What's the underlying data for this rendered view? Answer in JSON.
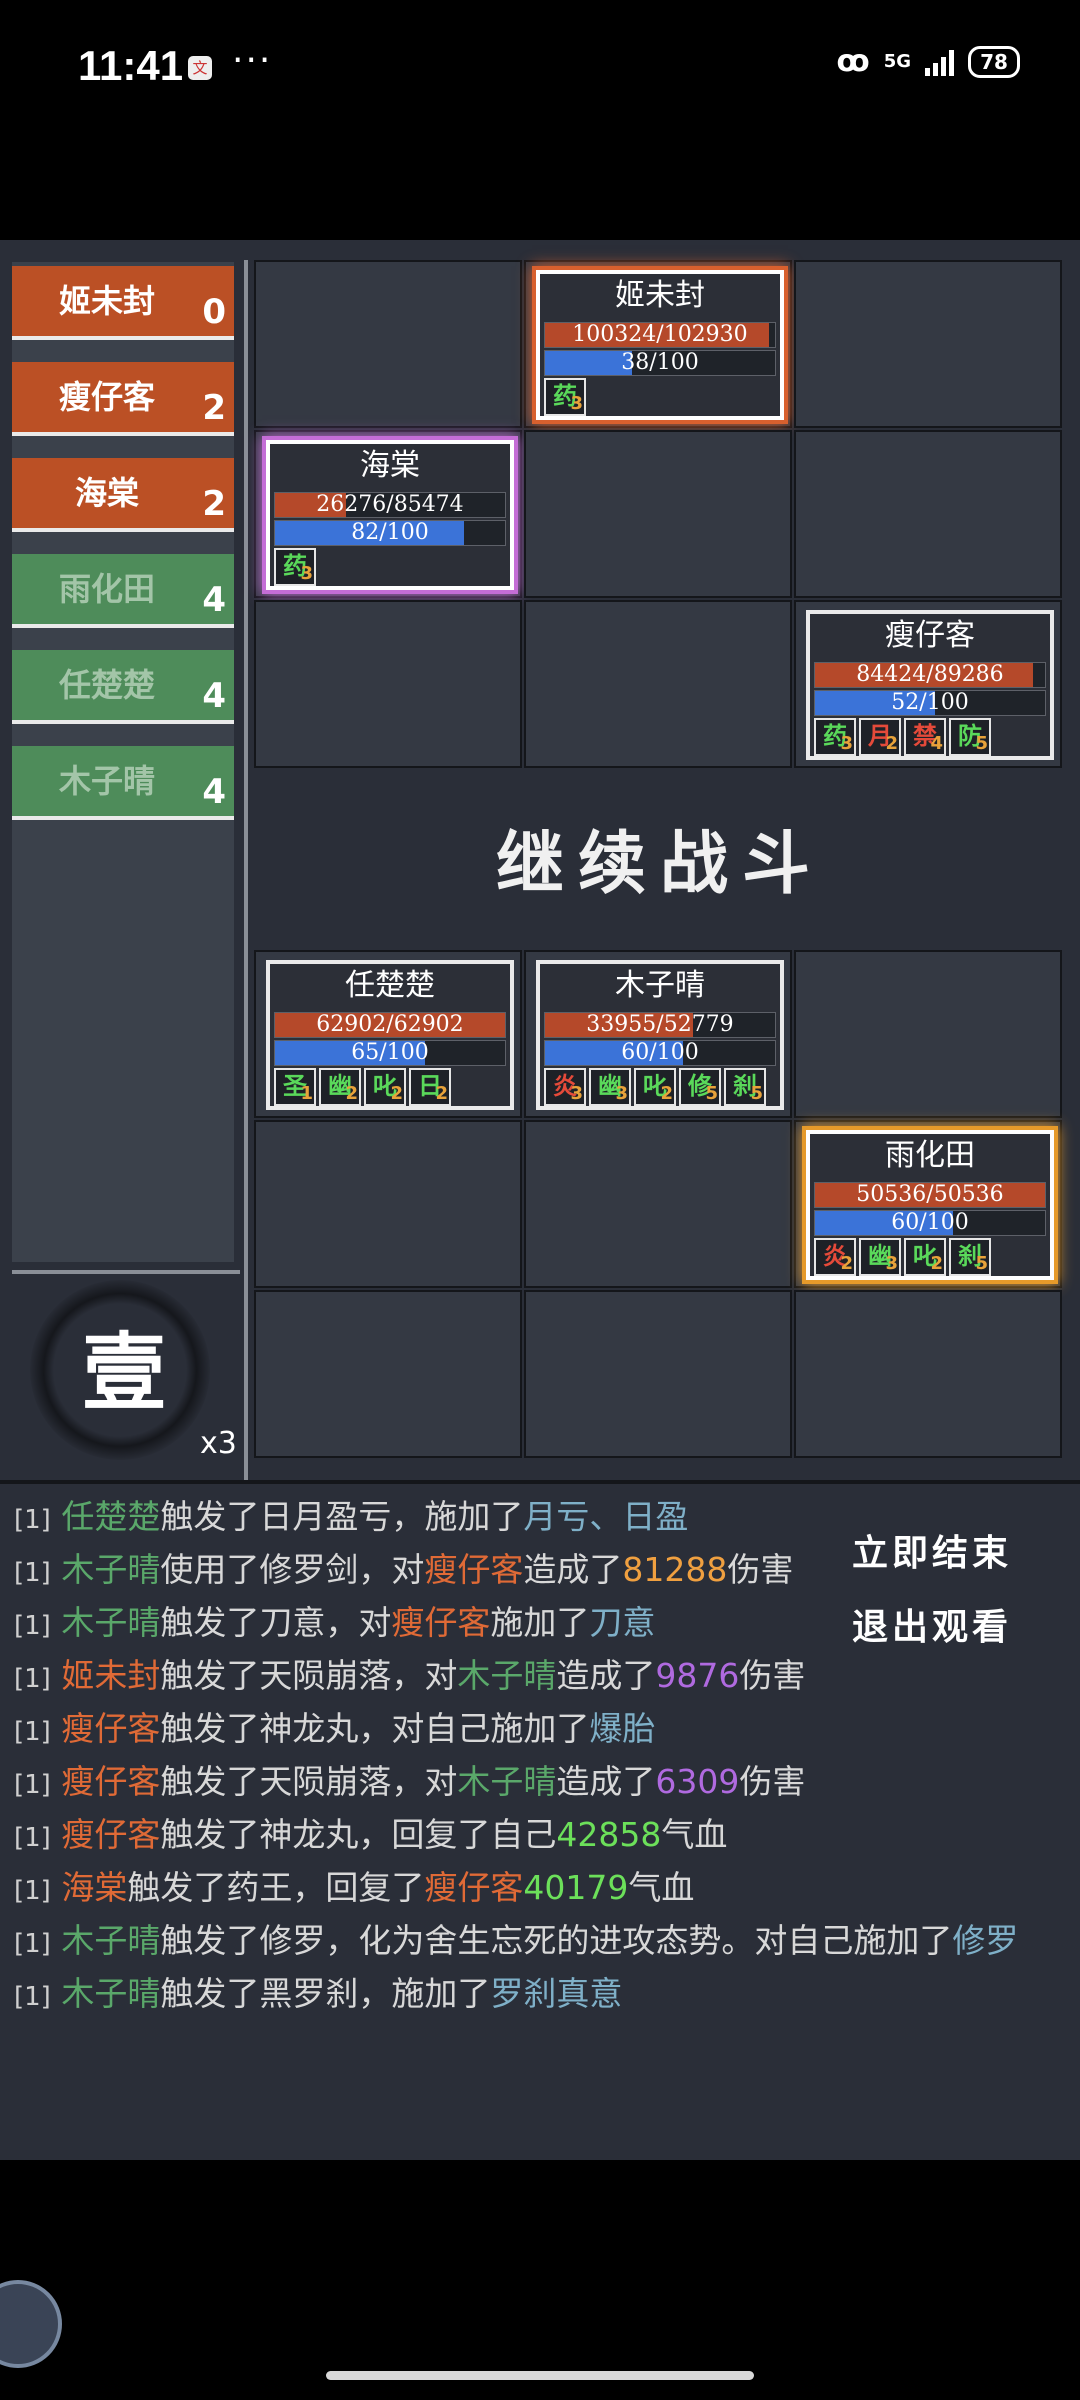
{
  "status_bar": {
    "time": "11:41",
    "network": "5G",
    "battery": "78"
  },
  "teams": [
    {
      "name": "姬未封",
      "count": "0",
      "color": "red"
    },
    {
      "name": "瘦仔客",
      "count": "2",
      "color": "red"
    },
    {
      "name": "海棠",
      "count": "2",
      "color": "red"
    },
    {
      "name": "雨化田",
      "count": "4",
      "color": "green"
    },
    {
      "name": "任楚楚",
      "count": "4",
      "color": "green"
    },
    {
      "name": "木子晴",
      "count": "4",
      "color": "green"
    }
  ],
  "round": {
    "char": "壹",
    "speed": "x3"
  },
  "enemy_units": {
    "ji": {
      "name": "姬未封",
      "hp": "100324/102930",
      "hp_frac": 0.975,
      "energy": "38/100",
      "energy_frac": 0.38,
      "buffs": [
        {
          "char": "药",
          "level": "3",
          "color": "green"
        }
      ]
    },
    "haitang": {
      "name": "海棠",
      "hp": "26276/85474",
      "hp_frac": 0.307,
      "energy": "82/100",
      "energy_frac": 0.82,
      "buffs": [
        {
          "char": "药",
          "level": "3",
          "color": "green"
        }
      ]
    },
    "shou": {
      "name": "瘦仔客",
      "hp": "84424/89286",
      "hp_frac": 0.946,
      "energy": "52/100",
      "energy_frac": 0.52,
      "buffs": [
        {
          "char": "药",
          "level": "3",
          "color": "green"
        },
        {
          "char": "月",
          "level": "2",
          "color": "red"
        },
        {
          "char": "禁",
          "level": "4",
          "color": "red"
        },
        {
          "char": "防",
          "level": "5",
          "color": "green"
        }
      ]
    }
  },
  "continue_label": "继续战斗",
  "ally_units": {
    "ren": {
      "name": "任楚楚",
      "hp": "62902/62902",
      "hp_frac": 1.0,
      "energy": "65/100",
      "energy_frac": 0.65,
      "buffs": [
        {
          "char": "圣",
          "level": "1",
          "color": "green"
        },
        {
          "char": "幽",
          "level": "2",
          "color": "green"
        },
        {
          "char": "叱",
          "level": "2",
          "color": "green"
        },
        {
          "char": "日",
          "level": "2",
          "color": "green"
        }
      ]
    },
    "mu": {
      "name": "木子晴",
      "hp": "33955/52779",
      "hp_frac": 0.643,
      "energy": "60/100",
      "energy_frac": 0.6,
      "buffs": [
        {
          "char": "炎",
          "level": "3",
          "color": "red"
        },
        {
          "char": "幽",
          "level": "3",
          "color": "green"
        },
        {
          "char": "叱",
          "level": "2",
          "color": "green"
        },
        {
          "char": "修",
          "level": "5",
          "color": "green"
        },
        {
          "char": "刹",
          "level": "5",
          "color": "green"
        }
      ]
    },
    "yu": {
      "name": "雨化田",
      "hp": "50536/50536",
      "hp_frac": 1.0,
      "energy": "60/100",
      "energy_frac": 0.6,
      "buffs": [
        {
          "char": "炎",
          "level": "2",
          "color": "red"
        },
        {
          "char": "幽",
          "level": "3",
          "color": "green"
        },
        {
          "char": "叱",
          "level": "2",
          "color": "green"
        },
        {
          "char": "刹",
          "level": "5",
          "color": "green"
        }
      ]
    }
  },
  "log": {
    "tag": "[1]",
    "l1": {
      "name": "任楚楚",
      "t1": "触发了日月盈亏，施加了",
      "effect": "月亏、日盈"
    },
    "l2": {
      "name": "木子晴",
      "t1": "使用了修罗剑，对",
      "target": "瘦仔客",
      "t2": "造成了",
      "value": "81288",
      "t3": "伤害"
    },
    "l3": {
      "name": "木子晴",
      "t1": "触发了刀意，对",
      "target": "瘦仔客",
      "t2": "施加了",
      "effect": "刀意"
    },
    "l4": {
      "name": "姬未封",
      "t1": "触发了天陨崩落，对",
      "target": "木子晴",
      "t2": "造成了",
      "value": "9876",
      "t3": "伤害"
    },
    "l5": {
      "name": "瘦仔客",
      "t1": "触发了神龙丸，对自己施加了",
      "effect": "爆胎"
    },
    "l6": {
      "name": "瘦仔客",
      "t1": "触发了天陨崩落，对",
      "target": "木子晴",
      "t2": "造成了",
      "value": "6309",
      "t3": "伤害"
    },
    "l7": {
      "name": "瘦仔客",
      "t1": "触发了神龙丸，回复了自己",
      "value": "42858",
      "t2": "气血"
    },
    "l8": {
      "name": "海棠",
      "t1": "触发了药王，回复了",
      "target": "瘦仔客",
      "value": "40179",
      "t2": "气血"
    },
    "l9": {
      "name": "木子晴",
      "t1": "触发了修罗，化为舍生忘死的进攻态势。对自己施加了",
      "effect": "修罗"
    },
    "l10": {
      "name": "木子晴",
      "t1": "触发了黑罗刹，施加了",
      "effect": "罗刹真意"
    }
  },
  "buttons": {
    "end_now": "立即结束",
    "exit_watch": "退出观看"
  }
}
